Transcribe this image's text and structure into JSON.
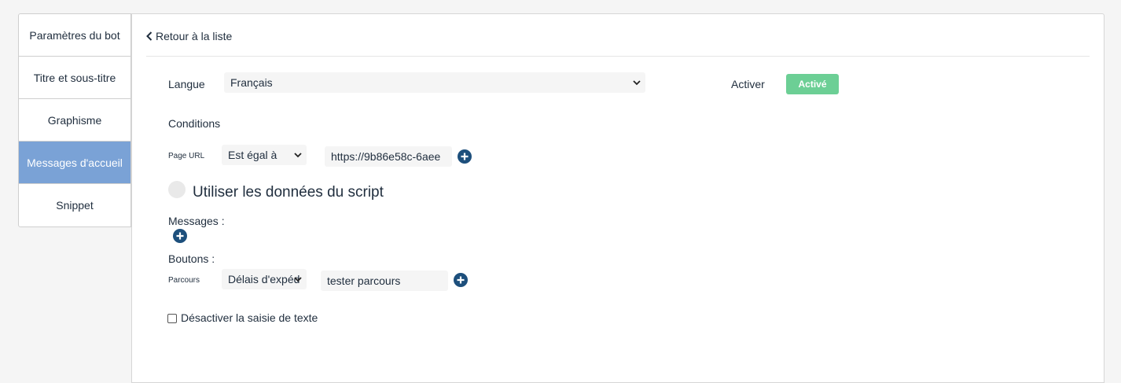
{
  "sidebar": {
    "items": [
      {
        "label": "Paramètres du bot"
      },
      {
        "label": "Titre et sous-titre"
      },
      {
        "label": "Graphisme"
      },
      {
        "label": "Messages d'accueil"
      },
      {
        "label": "Snippet"
      }
    ],
    "active_index": 3
  },
  "header": {
    "back_label": "Retour à la liste"
  },
  "language": {
    "label": "Langue",
    "selected": "Français"
  },
  "activate": {
    "label": "Activer",
    "status": "Activé",
    "status_color": "#6ccf95"
  },
  "conditions": {
    "title": "Conditions",
    "row": {
      "field_label": "Page URL",
      "operator": "Est égal à",
      "value": "https://9b86e58c-6aee"
    }
  },
  "script_toggle": {
    "label": "Utiliser les données du script"
  },
  "messages": {
    "label": "Messages :"
  },
  "buttons": {
    "label": "Boutons :",
    "row": {
      "type_label": "Parcours",
      "select_value": "Délais d'expéd",
      "text_value": "tester parcours"
    }
  },
  "disable_text": {
    "label": "Désactiver la saisie de texte"
  },
  "icons": {
    "plus": "plus-circle-icon",
    "back": "chevron-left-icon",
    "dropdown": "chevron-down-icon"
  },
  "colors": {
    "accent": "#7aa2d6",
    "plus_icon": "#1d4f7c"
  }
}
